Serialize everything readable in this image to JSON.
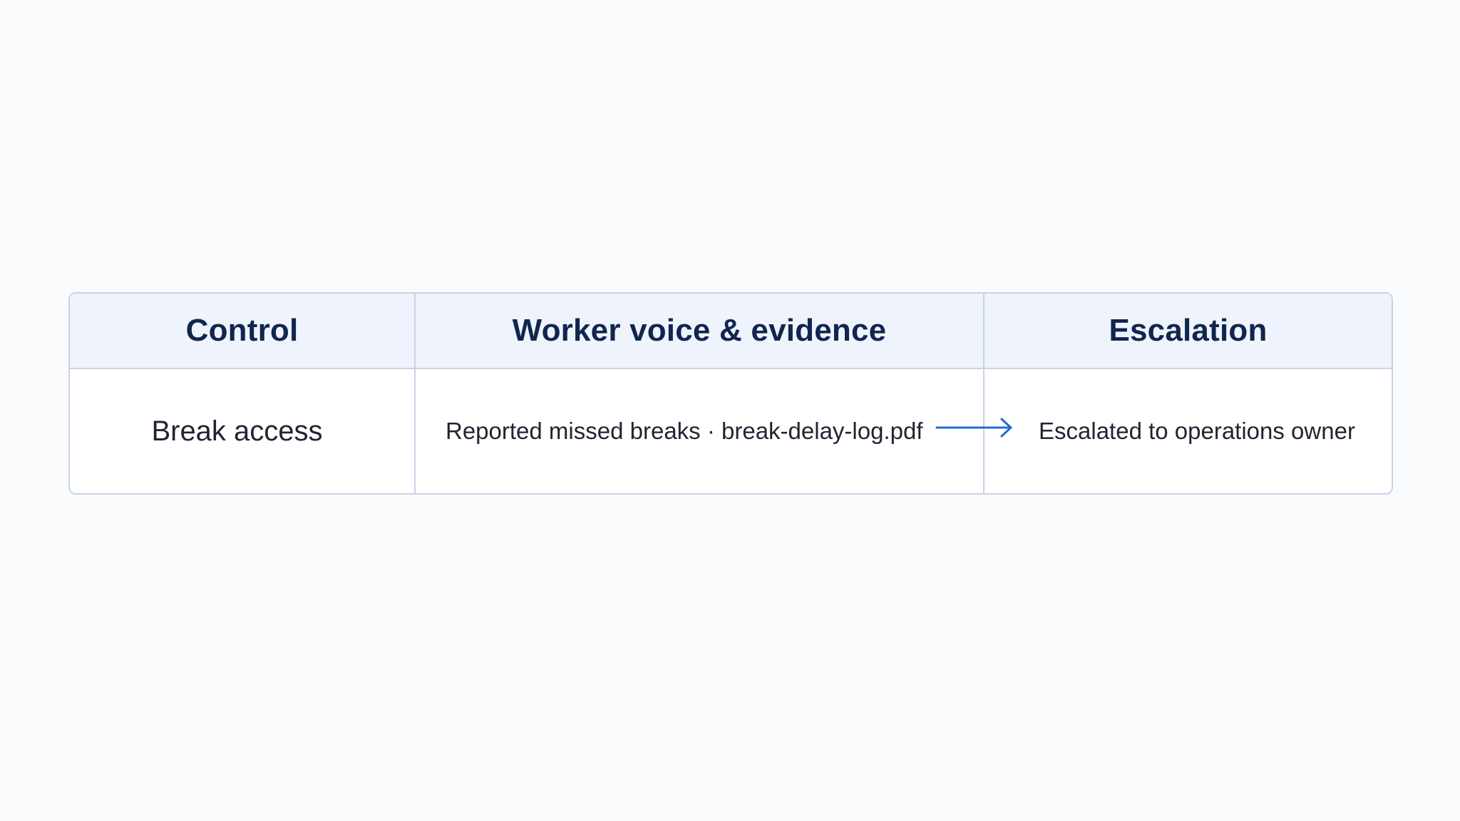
{
  "table": {
    "headers": {
      "control": "Control",
      "evidence": "Worker voice & evidence",
      "escalation": "Escalation"
    },
    "rows": [
      {
        "control": "Break access",
        "evidence": "Reported missed breaks · break-delay-log.pdf",
        "escalation": "Escalated to operations owner"
      }
    ]
  },
  "icons": {
    "flow_arrow": "arrow-right-icon"
  },
  "colors": {
    "header_text": "#10264f",
    "header_background": "#eff4fc",
    "border": "#c9d3e6",
    "arrow": "#1e6fd0",
    "body_text": "#1f2530"
  }
}
